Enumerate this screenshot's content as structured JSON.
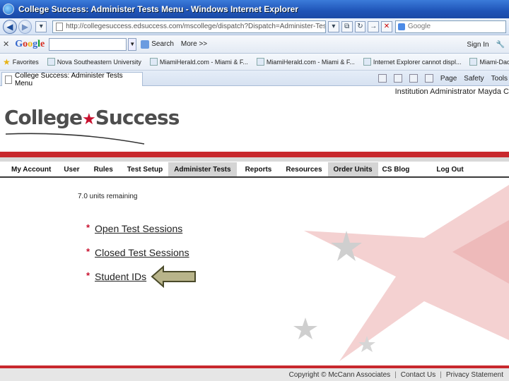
{
  "window": {
    "title": "College Success: Administer Tests Menu - Windows Internet Explorer"
  },
  "address": {
    "url": "http://collegesuccess.edsuccess.com/mscollege/dispatch?Dispatch=Administer-Tests Menu",
    "search_placeholder": "Google"
  },
  "google_toolbar": {
    "logo_letters": [
      "G",
      "o",
      "o",
      "g",
      "l",
      "e"
    ],
    "search_label": "Search",
    "more_label": "More >>",
    "sign_in": "Sign In"
  },
  "favorites": {
    "label": "Favorites",
    "items": [
      "Nova Southeastern University",
      "MiamiHerald.com - Miami & F...",
      "MiamiHerald.com - Miami & F...",
      "Internet Explorer cannot displ...",
      "Miami-Dade County Public S..."
    ]
  },
  "tab": {
    "label": "College Success: Administer Tests Menu"
  },
  "command_bar": {
    "page": "Page",
    "safety": "Safety",
    "tools": "Tools"
  },
  "site": {
    "user_role": "Institution Administrator  Mayda C",
    "logo_left": "College",
    "logo_right": "Success"
  },
  "nav": {
    "items": [
      {
        "label": "My Account",
        "shaded": false
      },
      {
        "label": "User",
        "shaded": false
      },
      {
        "label": "Rules",
        "shaded": false
      },
      {
        "label": "Test Setup",
        "shaded": false
      },
      {
        "label": "Administer Tests",
        "shaded": true
      },
      {
        "label": "Reports",
        "shaded": false
      },
      {
        "label": "Resources",
        "shaded": false
      },
      {
        "label": "Order Units",
        "shaded": true
      },
      {
        "label": "CS Blog",
        "shaded": false
      },
      {
        "label": "Log Out",
        "shaded": false
      }
    ]
  },
  "main": {
    "units_remaining": "7.0 units remaining",
    "links": [
      "Open Test Sessions",
      "Closed Test Sessions",
      "Student IDs"
    ]
  },
  "footer": {
    "copyright": "Copyright © McCann Associates",
    "contact": "Contact Us",
    "privacy": "Privacy Statement"
  },
  "colors": {
    "brand_red": "#c8282d",
    "arrow_fill": "#b8b48a"
  }
}
